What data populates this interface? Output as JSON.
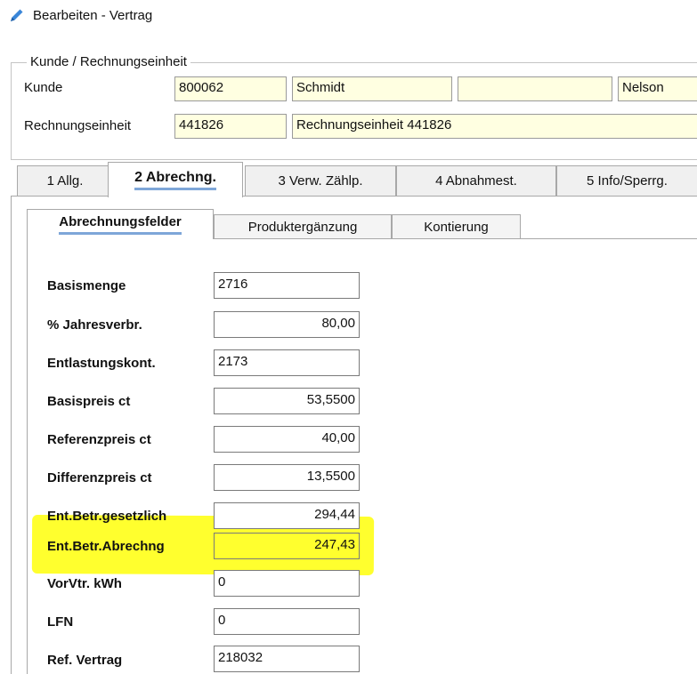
{
  "window": {
    "title": "Bearbeiten - Vertrag",
    "icon": "pencil-icon"
  },
  "customer_group": {
    "title": "Kunde / Rechnungseinheit",
    "kunde": {
      "label": "Kunde",
      "number": "800062",
      "name": "Schmidt",
      "extra": "",
      "firstname": "Nelson"
    },
    "rechnungseinheit": {
      "label": "Rechnungseinheit",
      "number": "441826",
      "name": "Rechnungseinheit 441826"
    }
  },
  "tabs": [
    {
      "label": "1 Allg.",
      "active": false
    },
    {
      "label": "2 Abrechng.",
      "active": true
    },
    {
      "label": "3 Verw. Zählp.",
      "active": false
    },
    {
      "label": "4 Abnahmest.",
      "active": false
    },
    {
      "label": "5 Info/Sperrg.",
      "active": false
    }
  ],
  "subtabs": [
    {
      "label": "Abrechnungsfelder",
      "active": true
    },
    {
      "label": "Produktergänzung",
      "active": false
    },
    {
      "label": "Kontierung",
      "active": false
    }
  ],
  "fields": [
    {
      "label": "Basismenge",
      "value": "2716",
      "align": "left"
    },
    {
      "label": "% Jahresverbr.",
      "value": "80,00",
      "align": "right"
    },
    {
      "label": "Entlastungskont.",
      "value": "2173",
      "align": "left"
    },
    {
      "label": "Basispreis ct",
      "value": "53,5500",
      "align": "right"
    },
    {
      "label": "Referenzpreis ct",
      "value": "40,00",
      "align": "right"
    },
    {
      "label": "Differenzpreis ct",
      "value": "13,5500",
      "align": "right"
    },
    {
      "label": "Ent.Betr.gesetzlich",
      "value": "294,44",
      "align": "right"
    },
    {
      "label": "Ent.Betr.Abrechng",
      "value": "247,43",
      "align": "right",
      "highlighted": true
    },
    {
      "label": "VorVtr. kWh",
      "value": "0",
      "align": "left"
    },
    {
      "label": "LFN",
      "value": "0",
      "align": "left"
    },
    {
      "label": "Ref. Vertrag",
      "value": "218032",
      "align": "left"
    }
  ],
  "colors": {
    "field_bg": "#ffffe1",
    "highlight": "#ffff2e",
    "tab_accent": "#7ea6d8",
    "pencil": "#3a86d8"
  }
}
